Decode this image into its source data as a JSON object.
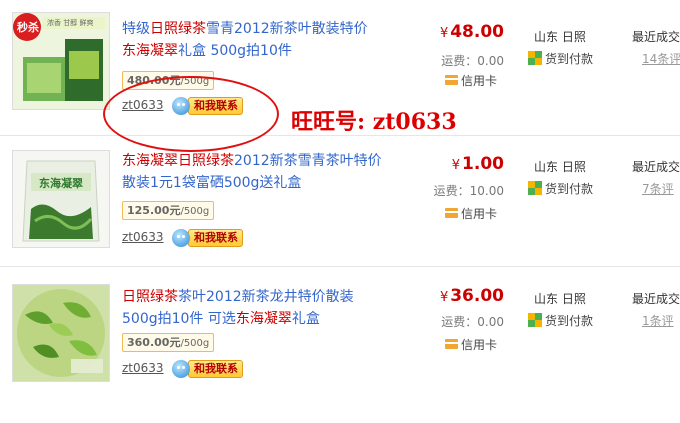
{
  "listings": [
    {
      "title_parts": [
        {
          "text": "特级",
          "hl": false
        },
        {
          "text": "日照绿茶",
          "hl": true
        },
        {
          "text": "雪青2012新茶叶散装特价 ",
          "hl": false
        },
        {
          "text": "东海凝翠",
          "hl": true
        },
        {
          "text": "礼盒 500g拍10件",
          "hl": false
        }
      ],
      "badge_text": "秒杀",
      "tagline": "浓香 甘醇 鲜爽",
      "weight_price": "480.00元",
      "weight_unit": "/500g",
      "seller": "zt0633",
      "contact_label": "和我联系",
      "price_symbol": "¥",
      "price": "48.00",
      "shipping": "运费：0.00",
      "credit": "信用卡",
      "location": "山东 日照",
      "cod": "货到付款",
      "recent": "最近成交",
      "reviews": "14条评"
    },
    {
      "title_parts": [
        {
          "text": "东海凝翠日照绿茶",
          "hl": true
        },
        {
          "text": "2012新茶雪青茶叶特价散装1元1袋富硒500g送礼盒",
          "hl": false
        }
      ],
      "pack_label": "东海凝翠",
      "weight_price": "125.00元",
      "weight_unit": "/500g",
      "seller": "zt0633",
      "contact_label": "和我联系",
      "price_symbol": "¥",
      "price": "1.00",
      "shipping": "运费：10.00",
      "credit": "信用卡",
      "location": "山东 日照",
      "cod": "货到付款",
      "recent": "最近成交",
      "reviews": "7条评"
    },
    {
      "title_parts": [
        {
          "text": "日照绿茶",
          "hl": true
        },
        {
          "text": "茶叶2012新茶龙井特价散装 500g拍10件 可选",
          "hl": false
        },
        {
          "text": "东海凝翠",
          "hl": true
        },
        {
          "text": "礼盒",
          "hl": false
        }
      ],
      "weight_price": "360.00元",
      "weight_unit": "/500g",
      "seller": "zt0633",
      "contact_label": "和我联系",
      "price_symbol": "¥",
      "price": "36.00",
      "shipping": "运费：0.00",
      "credit": "信用卡",
      "location": "山东 日照",
      "cod": "货到付款",
      "recent": "最近成交",
      "reviews": "1条评"
    }
  ],
  "annotation": "旺旺号: zt0633",
  "colors": {
    "link": "#3366cc",
    "highlight": "#cc0000",
    "price": "#cc0000",
    "annotation": "#dd0000"
  }
}
